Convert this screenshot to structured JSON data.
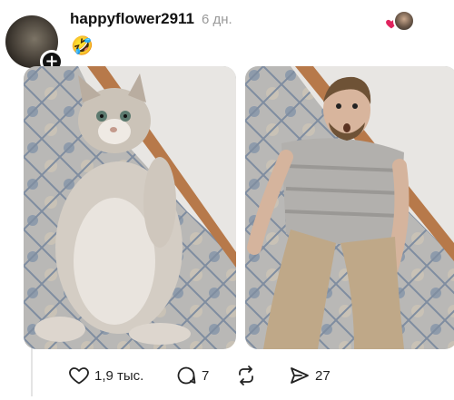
{
  "post": {
    "username": "happyflower2911",
    "time": "6 дн.",
    "text": "🤣",
    "avatar_icon": "user-avatar",
    "liker_icons": [
      "heart-icon",
      "liker-avatar"
    ]
  },
  "media": [
    {
      "name": "cat-photo",
      "subject": "cat-lying-on-carpet"
    },
    {
      "name": "man-photo",
      "subject": "man-lying-on-carpet"
    }
  ],
  "actions": {
    "likes": "1,9 тыс.",
    "replies": "7",
    "reposts": "",
    "shares": "27"
  },
  "colors": {
    "heart": "#e0245e",
    "text": "#111111",
    "muted": "#999999"
  }
}
